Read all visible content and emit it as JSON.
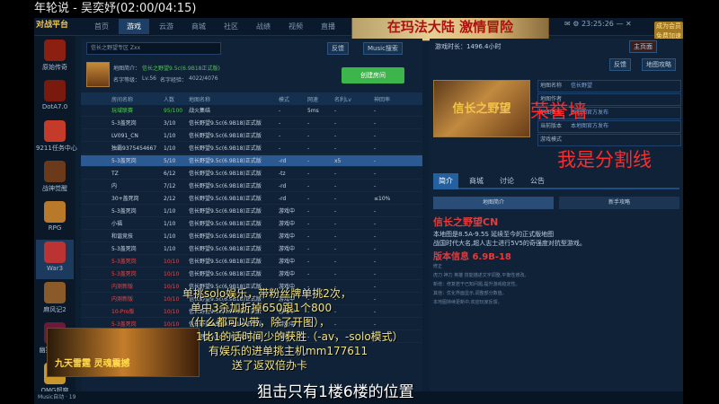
{
  "stream": {
    "title": "年轮说 - 吴奕妤(02:00/04:15)"
  },
  "topbar": {
    "logo": "对战平台",
    "nav": [
      "首页",
      "游戏",
      "云游",
      "商城",
      "社区",
      "战绩",
      "视频",
      "直播"
    ],
    "active_index": 1,
    "banner": "在玛法大陆 激情冒险",
    "time": "23:25:26",
    "coin_label": "成为会员免费加速"
  },
  "sidebar": {
    "items": [
      {
        "label": "原始传奇",
        "icon": "legend-icon",
        "color": "#8b1f12"
      },
      {
        "label": "DotA7.0",
        "icon": "dota-icon",
        "color": "#7a1a0e"
      },
      {
        "label": "9211任务中心",
        "icon": "task-icon",
        "color": "#c43b2a"
      },
      {
        "label": "战神觉醒",
        "icon": "warrior-icon",
        "color": "#6a3a1a"
      },
      {
        "label": "RPG",
        "icon": "rpg-icon",
        "color": "#b87a2a"
      },
      {
        "label": "War3",
        "icon": "war3-icon",
        "color": "#b33",
        "active": true
      },
      {
        "label": "麻风记2",
        "icon": "game-icon",
        "color": "#8a5a2a"
      },
      {
        "label": "幽冥天子煞",
        "icon": "ghost-icon",
        "color": "#6b1a3a"
      },
      {
        "label": "OMG超爽",
        "icon": "omg-icon",
        "color": "#c8962a"
      }
    ]
  },
  "main": {
    "search": "信长之野望专区 Zxx",
    "btn_friends": "反馈",
    "btn_music": "Music搜索",
    "map_label": "地图简介：",
    "map_value": "信长之野望9.5c(6.9B18正式版)",
    "level_label": "名字等级：",
    "level_value": "Lv.56",
    "exp_label": "名字经验：",
    "exp_value": "4022/4076",
    "join": "创建房间",
    "columns": [
      "房间名称",
      "人数",
      "地图名称",
      "模式",
      "网速",
      "名利Lv",
      "神回率"
    ],
    "rows": [
      {
        "name": "玩域联赛",
        "players": "95/100",
        "map": "战火集结",
        "mode": "-",
        "net": "5ms",
        "lv": "-",
        "rate": "-",
        "cls": "g"
      },
      {
        "name": "5-3盖死岗",
        "players": "3/10",
        "map": "信长野望9.5c(6.9B18)正式版",
        "mode": "-",
        "net": "-",
        "lv": "-",
        "rate": "-",
        "cls": ""
      },
      {
        "name": "LV091_CN",
        "players": "1/10",
        "map": "信长野望9.5c(6.9B18)正式版",
        "mode": "-",
        "net": "-",
        "lv": "-",
        "rate": "-",
        "cls": ""
      },
      {
        "name": "独霸9375454667",
        "players": "1/10",
        "map": "信长野望9.5c(6.9B18)正式版",
        "mode": "-",
        "net": "-",
        "lv": "-",
        "rate": "-",
        "cls": ""
      },
      {
        "name": "5-3盖死岗",
        "players": "5/10",
        "map": "信长野望9.5c(6.9B18)正式版",
        "mode": "-rd",
        "net": "-",
        "lv": "x5",
        "rate": "-",
        "cls": "",
        "selected": true
      },
      {
        "name": "TZ",
        "players": "6/12",
        "map": "信长野望9.5c(6.9B18)正式版",
        "mode": "-tz",
        "net": "-",
        "lv": "-",
        "rate": "-",
        "cls": ""
      },
      {
        "name": "内",
        "players": "7/12",
        "map": "信长野望9.5c(6.9B18)正式版",
        "mode": "-rd",
        "net": "-",
        "lv": "-",
        "rate": "-",
        "cls": ""
      },
      {
        "name": "30+盖死岗",
        "players": "2/12",
        "map": "信长野望9.5c(6.9B18)正式版",
        "mode": "-rd",
        "net": "-",
        "lv": "-",
        "rate": "≤10%",
        "cls": ""
      },
      {
        "name": "5-3盖死岗",
        "players": "1/10",
        "map": "信长野望9.5c(6.9B18)正式版",
        "mode": "游戏中",
        "net": "-",
        "lv": "-",
        "rate": "-",
        "cls": ""
      },
      {
        "name": "小福",
        "players": "1/10",
        "map": "信长野望9.5c(6.9B18)正式版",
        "mode": "游戏中",
        "net": "-",
        "lv": "-",
        "rate": "-",
        "cls": ""
      },
      {
        "name": "和谐竞技",
        "players": "1/10",
        "map": "信长野望9.5c(6.9B18)正式版",
        "mode": "游戏中",
        "net": "-",
        "lv": "-",
        "rate": "-",
        "cls": ""
      },
      {
        "name": "5-3盖死岗",
        "players": "1/10",
        "map": "信长野望9.5c(6.9B18)正式版",
        "mode": "游戏中",
        "net": "-",
        "lv": "-",
        "rate": "-",
        "cls": ""
      },
      {
        "name": "5-3盖死岗",
        "players": "10/10",
        "map": "信长野望9.5c(6.9B18)正式版",
        "mode": "游戏中",
        "net": "-",
        "lv": "-",
        "rate": "-",
        "cls": "r"
      },
      {
        "name": "5-3盖死岗",
        "players": "10/10",
        "map": "信长野望9.5c(6.9B18)正式版",
        "mode": "游戏中",
        "net": "-",
        "lv": "-",
        "rate": "-",
        "cls": "r"
      },
      {
        "name": "内测新版",
        "players": "10/10",
        "map": "信长野望9.5c(6.9B18)正式版",
        "mode": "游戏中",
        "net": "-",
        "lv": "-",
        "rate": "-",
        "cls": "r"
      },
      {
        "name": "内测新版",
        "players": "10/10",
        "map": "信长野望9.5c(6.9B18)正式版",
        "mode": "游戏中",
        "net": "-",
        "lv": "-",
        "rate": "-",
        "cls": "r"
      },
      {
        "name": "10-Pro版",
        "players": "10/10",
        "map": "信长野望9.5c(6.9B18)正式版",
        "mode": "游戏中",
        "net": "-",
        "lv": "-",
        "rate": "-",
        "cls": "r"
      },
      {
        "name": "5-3盖死岗",
        "players": "10/10",
        "map": "信长野望9.5c(6.9B18)正式版",
        "mode": "游戏中",
        "net": "-",
        "lv": "-",
        "rate": "-",
        "cls": "r"
      },
      {
        "name": "内测新版",
        "players": "10/10",
        "map": "信长野望9.5c(6.9B18)正式版",
        "mode": "游戏中",
        "net": "-",
        "lv": "-",
        "rate": "-",
        "cls": "r"
      }
    ]
  },
  "right": {
    "duration": "游戏时长：1496.4小时",
    "btn1": "主页面",
    "btn2": "反馈",
    "btn3": "地图攻略",
    "game_img_text": "信长之野望",
    "info": [
      {
        "k": "地图名称",
        "v": "信长野望"
      },
      {
        "k": "地图作者",
        "v": ""
      },
      {
        "k": "地图类型",
        "v": "本地图官方发布"
      },
      {
        "k": "当前版本",
        "v": "本地图官方发布"
      },
      {
        "k": "游戏模式",
        "v": ""
      }
    ],
    "tabs": [
      "简介",
      "商城",
      "讨论",
      "公告"
    ],
    "subtabs": [
      "地图简介",
      "新手攻略"
    ],
    "map_title": "信长之野望CN",
    "desc1": "本地图是8.5A-9.5S 延续至今的正式版地图",
    "desc2": "战国时代大名,超人志士进行5V5的奇强度对抗型游戏。",
    "version": "版本信息 6.9B-18",
    "notes": [
      "修正",
      "虎刀 神力 英雄 技能描述文字调整,平衡性修改。",
      "新增：修复若干已知问题,提升游戏稳定性。",
      "其他：优化界面显示,调整部分数值。",
      "本地图持续更新中,欢迎玩家反馈。"
    ]
  },
  "overlay": {
    "honor": "荣誉墙",
    "divider": "我是分割线",
    "promo": "九天雷霆 灵魂震撼",
    "yellow": [
      "单挑solo娱乐，带粉丝牌单挑2次，",
      "单中3杀加折掉650跟1个800",
      "（什么都可以带，除了开图），",
      "1比1的话时间少的获胜（-av，-solo模式）",
      "有娱乐的进单挑主机mm177611",
      "送了返双倍办卡"
    ],
    "white": "狙击只有1楼6楼的位置"
  },
  "bottom": {
    "text": "Music自动 · 19"
  }
}
